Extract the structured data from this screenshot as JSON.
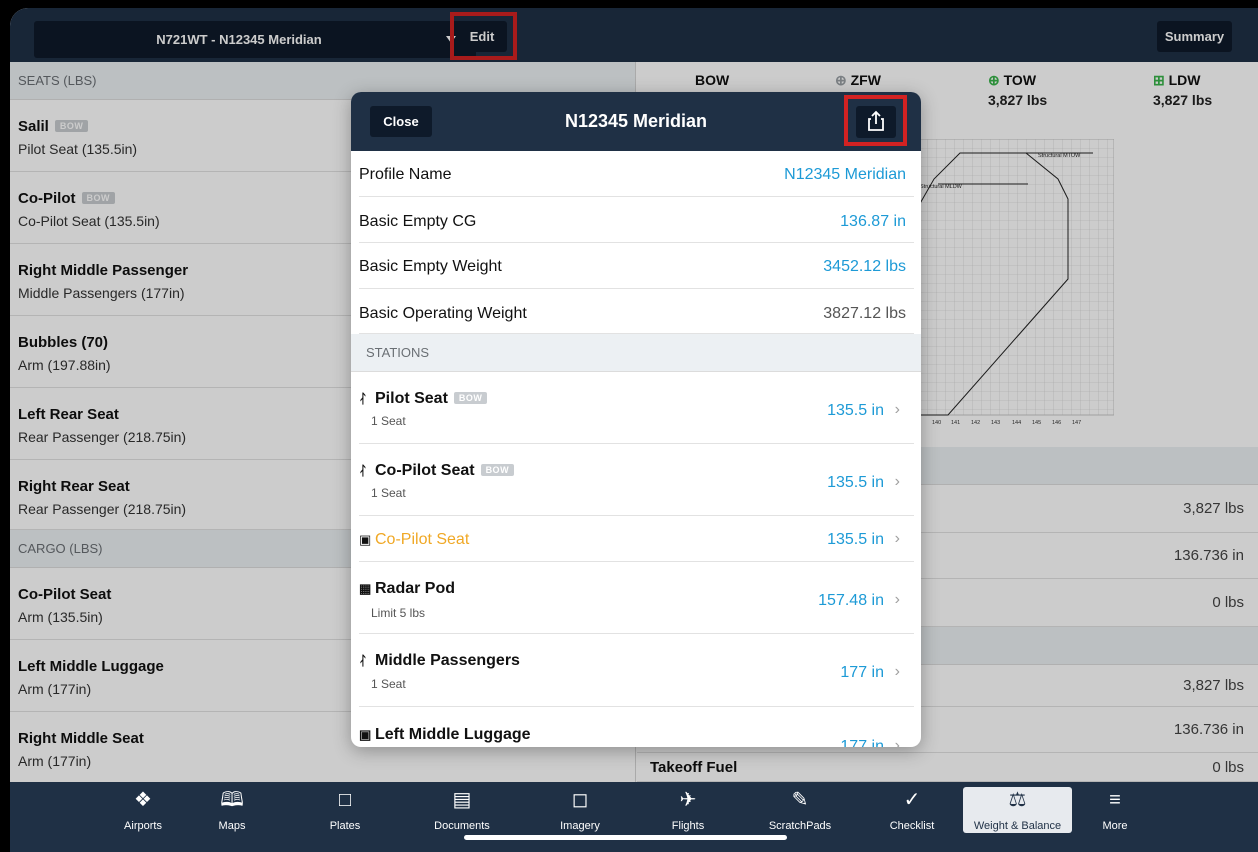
{
  "topbar": {
    "aircraft": "N721WT - N12345 Meridian",
    "edit_label": "Edit",
    "summary_label": "Summary"
  },
  "left": {
    "seats_header": "SEATS (LBS)",
    "seats": [
      {
        "name": "Salil",
        "tag": "BOW",
        "sub": "Pilot Seat (135.5in)"
      },
      {
        "name": "Co-Pilot",
        "tag": "BOW",
        "sub": "Co-Pilot Seat (135.5in)"
      },
      {
        "name": "Right Middle Passenger",
        "sub": "Middle Passengers (177in)"
      },
      {
        "name": "Bubbles (70)",
        "sub": "Arm (197.88in)"
      },
      {
        "name": "Left Rear Seat",
        "sub": "Rear Passenger (218.75in)"
      },
      {
        "name": "Right Rear Seat",
        "sub": "Rear Passenger (218.75in)"
      }
    ],
    "cargo_header": "CARGO (LBS)",
    "cargo": [
      {
        "name": "Co-Pilot Seat",
        "sub": "Arm (135.5in)"
      },
      {
        "name": "Left Middle Luggage",
        "sub": "Arm (177in)"
      },
      {
        "name": "Right Middle Seat",
        "sub": "Arm (177in)"
      }
    ]
  },
  "right": {
    "bow_label": "BOW",
    "zfw_label": "ZFW",
    "tow_label": "TOW",
    "tow_value": "3,827 lbs",
    "ldw_label": "LDW",
    "ldw_value": "3,827 lbs",
    "chart_labels": {
      "mtow": "Structural MTOW",
      "mldw": "Structural MLDW"
    },
    "chart_ticks": [
      "9",
      "140",
      "141",
      "142",
      "143",
      "144",
      "145",
      "146",
      "147"
    ],
    "values": [
      "3,827 lbs",
      "136.736 in",
      "0 lbs",
      "3,827 lbs",
      "136.736 in"
    ],
    "takeoff_fuel_label": "Takeoff Fuel",
    "takeoff_fuel_value": "0 lbs"
  },
  "modal": {
    "close_label": "Close",
    "title": "N12345 Meridian",
    "rows": [
      {
        "label": "Profile Name",
        "value": "N12345 Meridian"
      },
      {
        "label": "Basic Empty CG",
        "value": "136.87 in"
      },
      {
        "label": "Basic Empty Weight",
        "value": "3452.12 lbs"
      },
      {
        "label": "Basic Operating Weight",
        "value": "3827.12 lbs"
      }
    ],
    "stations_header": "STATIONS",
    "stations": [
      {
        "icon": "seat-icon",
        "name": "Pilot Seat",
        "tag": "BOW",
        "sub": "1 Seat",
        "value": "135.5 in"
      },
      {
        "icon": "seat-icon",
        "name": "Co-Pilot Seat",
        "tag": "BOW",
        "sub": "1 Seat",
        "value": "135.5 in"
      },
      {
        "icon": "cargo-box-icon",
        "name": "Co-Pilot Seat",
        "value": "135.5 in",
        "color": "#f0a825"
      },
      {
        "icon": "pod-grid-icon",
        "name": "Radar Pod",
        "sub": "Limit 5 lbs",
        "value": "157.48 in"
      },
      {
        "icon": "seat-icon",
        "name": "Middle Passengers",
        "sub": "1 Seat",
        "value": "177 in"
      },
      {
        "icon": "cargo-box-icon",
        "name": "Left Middle Luggage",
        "value": "177 in"
      }
    ]
  },
  "tabs": [
    {
      "icon": "airports-icon",
      "label": "Airports"
    },
    {
      "icon": "maps-icon",
      "label": "Maps"
    },
    {
      "icon": "plates-icon",
      "label": "Plates"
    },
    {
      "icon": "documents-icon",
      "label": "Documents"
    },
    {
      "icon": "imagery-icon",
      "label": "Imagery"
    },
    {
      "icon": "flights-icon",
      "label": "Flights"
    },
    {
      "icon": "scratchpads-icon",
      "label": "ScratchPads"
    },
    {
      "icon": "checklist-icon",
      "label": "Checklist"
    },
    {
      "icon": "weight-balance-icon",
      "label": "Weight & Balance"
    },
    {
      "icon": "more-icon",
      "label": "More"
    }
  ],
  "colors": {
    "nav": "#1f3045",
    "accent": "#1d9ad6",
    "highlight": "#d32222",
    "cargo": "#f0a825"
  }
}
